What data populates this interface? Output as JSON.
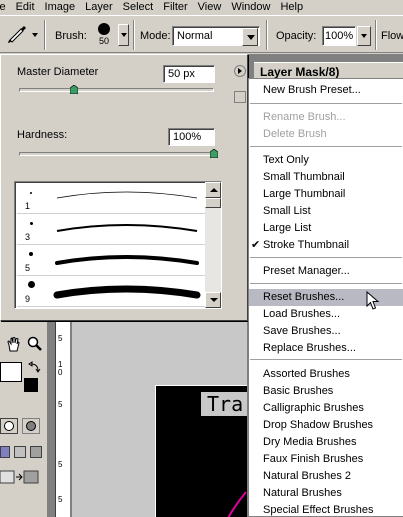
{
  "menubar": [
    "le",
    "Edit",
    "Image",
    "Layer",
    "Select",
    "Filter",
    "View",
    "Window",
    "Help"
  ],
  "options": {
    "brush_label": "Brush:",
    "brush_size": "50",
    "mode_label": "Mode:",
    "mode_value": "Normal",
    "opacity_label": "Opacity:",
    "opacity_value": "100%",
    "flow_label": "Flow"
  },
  "picker": {
    "master_diameter_label": "Master Diameter",
    "master_diameter_value": "50 px",
    "master_diameter_level": 0.28,
    "hardness_label": "Hardness:",
    "hardness_value": "100%",
    "hardness_level": 1.0,
    "brushes": [
      "1",
      "3",
      "5",
      "9"
    ]
  },
  "panel": {
    "layers_title": "Layer Mask/8)"
  },
  "menu": {
    "items": [
      {
        "label": "New Brush Preset...",
        "disabled": false
      },
      {
        "label": "Rename Brush...",
        "disabled": true
      },
      {
        "label": "Delete Brush",
        "disabled": true
      },
      {
        "label": "Text Only",
        "disabled": false
      },
      {
        "label": "Small Thumbnail",
        "disabled": false
      },
      {
        "label": "Large Thumbnail",
        "disabled": false
      },
      {
        "label": "Small List",
        "disabled": false
      },
      {
        "label": "Large List",
        "disabled": false
      },
      {
        "label": "Stroke Thumbnail",
        "disabled": false,
        "checked": true
      },
      {
        "label": "Preset Manager...",
        "disabled": false
      },
      {
        "label": "Reset Brushes...",
        "disabled": false,
        "highlighted": true
      },
      {
        "label": "Load Brushes...",
        "disabled": false
      },
      {
        "label": "Save Brushes...",
        "disabled": false
      },
      {
        "label": "Replace Brushes...",
        "disabled": false
      },
      {
        "label": "Assorted Brushes",
        "disabled": false
      },
      {
        "label": "Basic Brushes",
        "disabled": false
      },
      {
        "label": "Calligraphic Brushes",
        "disabled": false
      },
      {
        "label": "Drop Shadow Brushes",
        "disabled": false
      },
      {
        "label": "Dry Media Brushes",
        "disabled": false
      },
      {
        "label": "Faux Finish Brushes",
        "disabled": false
      },
      {
        "label": "Natural Brushes 2",
        "disabled": false
      },
      {
        "label": "Natural Brushes",
        "disabled": false
      },
      {
        "label": "Special Effect Brushes",
        "disabled": false
      }
    ]
  },
  "canvas": {
    "doc_text": "Tra",
    "ruler_marks": [
      "5",
      "1",
      "5",
      "0",
      "5",
      "5"
    ]
  },
  "colors": {
    "highlight": "#b9b9c4",
    "face": "#d4d0c8",
    "workspace": "#808080"
  }
}
